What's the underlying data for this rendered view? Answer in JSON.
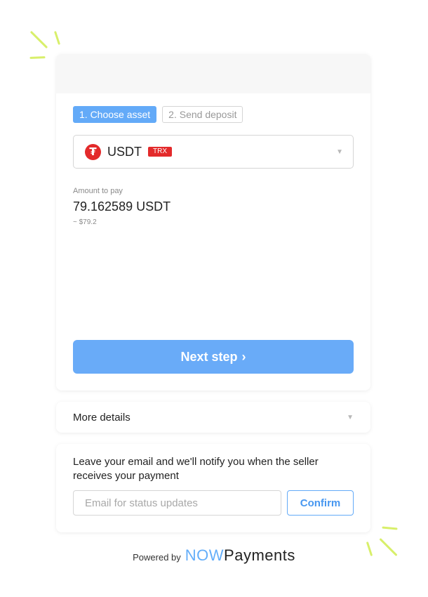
{
  "steps": [
    {
      "label": "1. Choose asset",
      "active": true
    },
    {
      "label": "2. Send deposit",
      "active": false
    }
  ],
  "asset": {
    "icon": "tether-icon",
    "icon_glyph": "₮",
    "name": "USDT",
    "network": "TRX",
    "caret": "▼"
  },
  "amount": {
    "label": "Amount to pay",
    "value": "79.162589 USDT",
    "fiat": "~ $79.2"
  },
  "next_button": {
    "label": "Next step",
    "chevron": "›"
  },
  "details": {
    "label": "More details",
    "caret": "▼"
  },
  "email": {
    "text": "Leave your email and we'll notify you when the seller receives your payment",
    "placeholder": "Email for status updates",
    "confirm_label": "Confirm"
  },
  "footer": {
    "powered_label": "Powered by",
    "brand_now": "NOW",
    "brand_payments": "Payments"
  },
  "colors": {
    "accent": "#69abf8",
    "tron_red": "#e32a2b",
    "sparkle": "#d8ef6a"
  }
}
